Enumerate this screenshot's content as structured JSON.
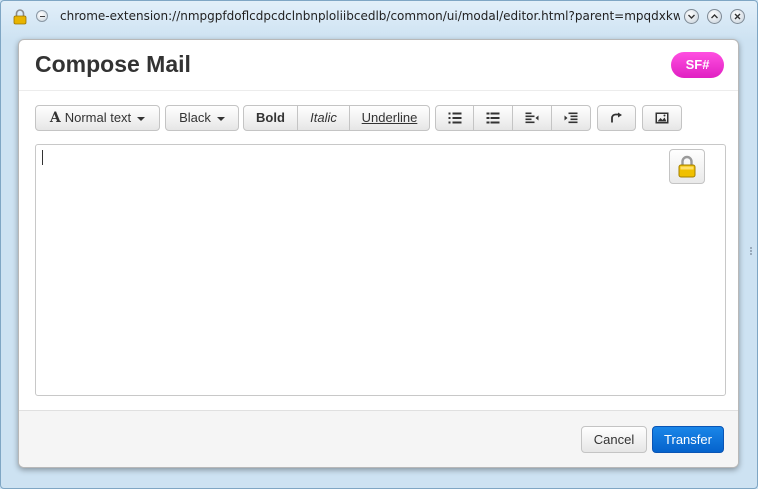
{
  "window": {
    "url": "chrome-extension://nmpgpfdoflcdpcdclnbnploliibcedlb/common/ui/modal/editor.html?parent=mpqdxkwu&..."
  },
  "dialog": {
    "title": "Compose Mail",
    "badge": "SF#"
  },
  "toolbar": {
    "text_style": "Normal text",
    "color": "Black",
    "bold": "Bold",
    "italic": "Italic",
    "underline": "Underline"
  },
  "footer": {
    "cancel": "Cancel",
    "transfer": "Transfer"
  },
  "colors": {
    "badge": "#e020c2",
    "primary_button": "#0a6fd8"
  }
}
